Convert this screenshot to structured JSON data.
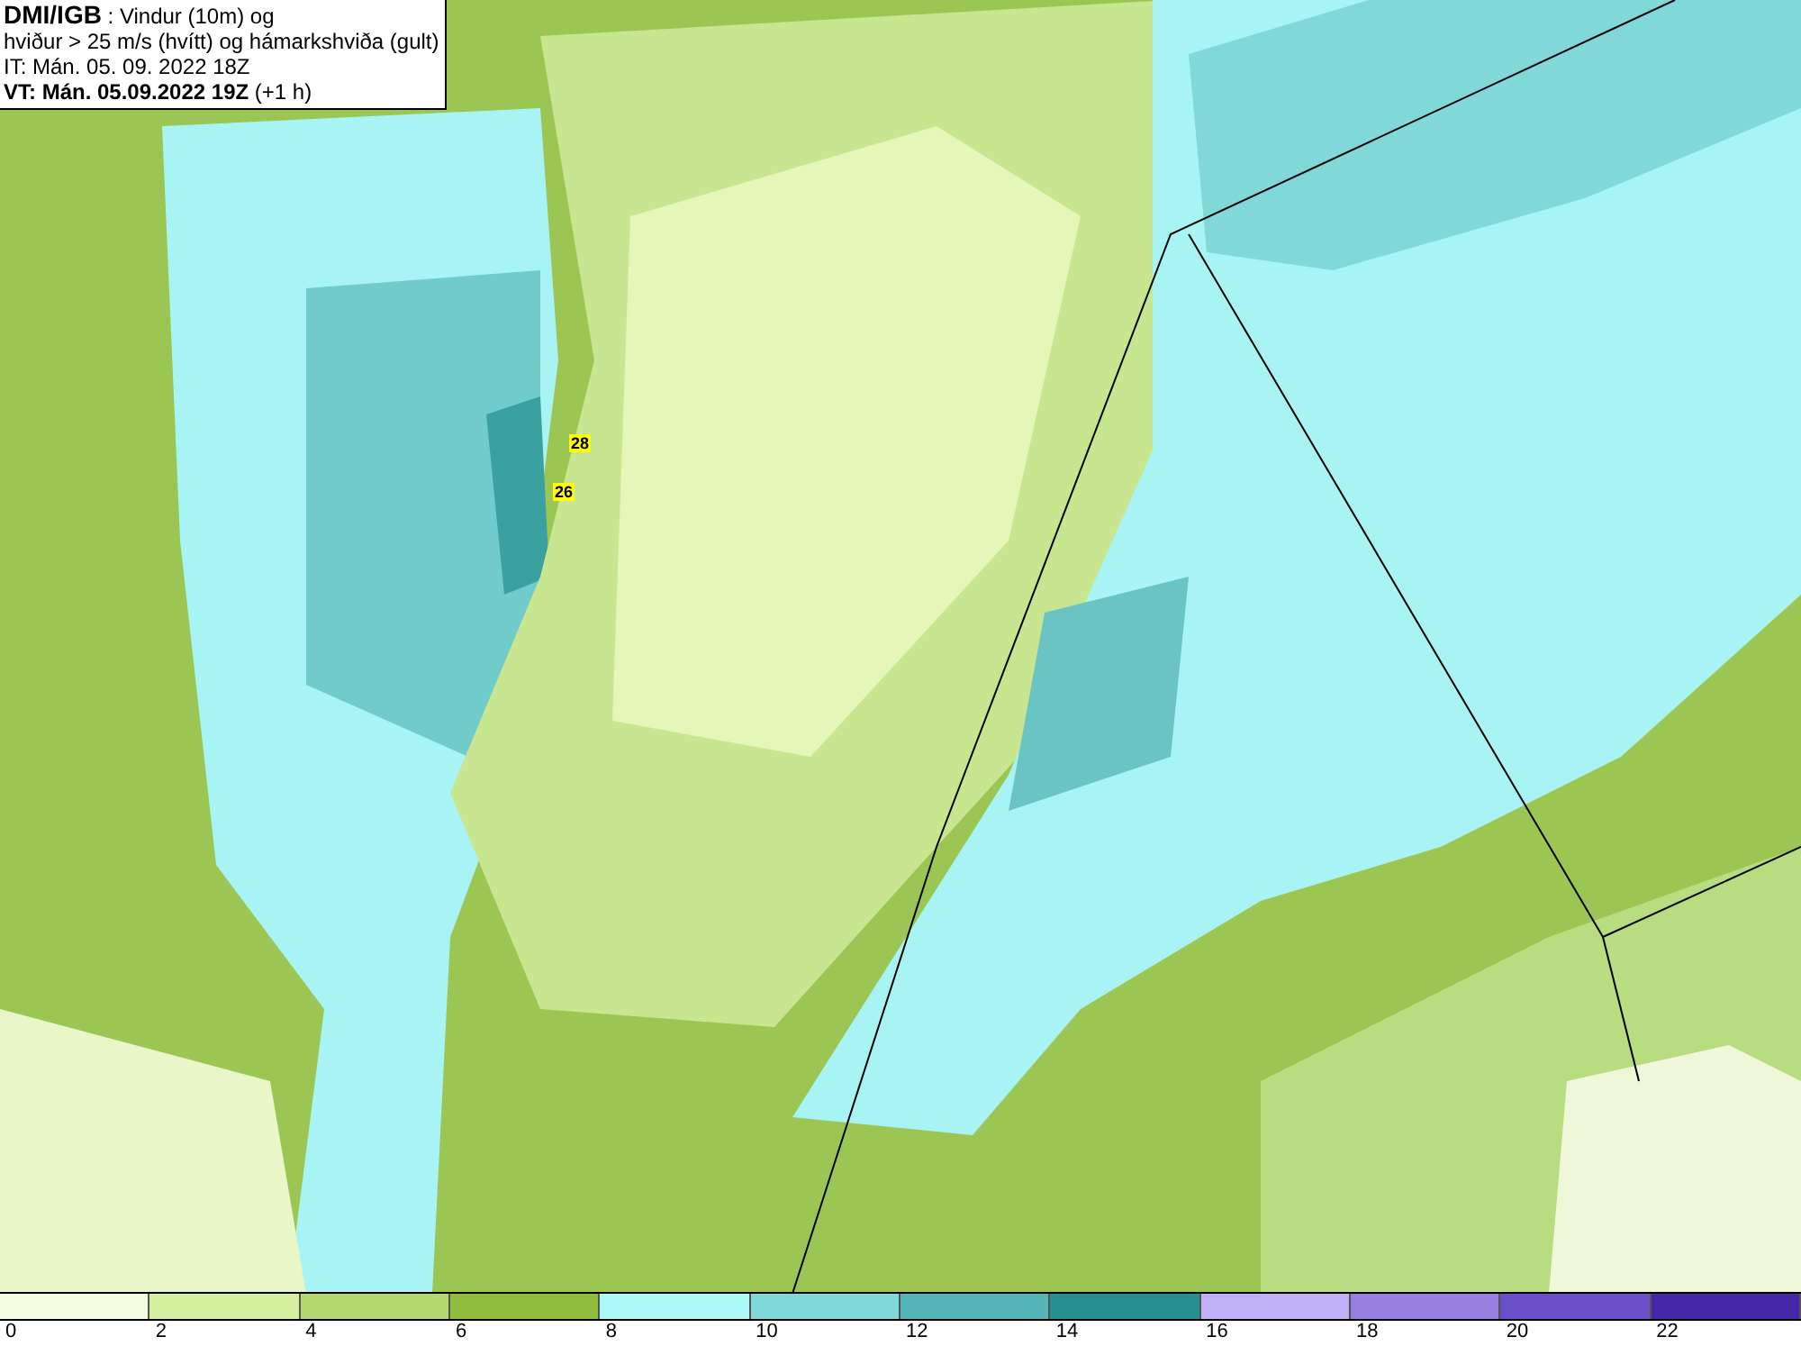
{
  "header": {
    "title": "DMI/IGB",
    "subtitle": " : Vindur (10m) og",
    "line2": "hviður > 25 m/s (hvítt) og hámarkshviða (gult)",
    "issue_time": "IT: Mán. 05. 09. 2022 18Z",
    "valid_time": "VT: Mán. 05.09.2022 19Z",
    "offset": " (+1 h)"
  },
  "map": {
    "gust_labels": [
      {
        "text": "28",
        "color": "#ffff00"
      },
      {
        "text": "26",
        "color": "#ffff00"
      }
    ]
  },
  "legend": [
    {
      "label": "0",
      "color": "#f5fde0"
    },
    {
      "label": "2",
      "color": "#d5efa0"
    },
    {
      "label": "4",
      "color": "#b3d870"
    },
    {
      "label": "6",
      "color": "#8fbe3c"
    },
    {
      "label": "8",
      "color": "#aaf8f8"
    },
    {
      "label": "10",
      "color": "#80d8d8"
    },
    {
      "label": "12",
      "color": "#55b5b8"
    },
    {
      "label": "14",
      "color": "#25908f"
    },
    {
      "label": "16",
      "color": "#c0b0f5"
    },
    {
      "label": "18",
      "color": "#9580e0"
    },
    {
      "label": "20",
      "color": "#6a50c8"
    },
    {
      "label": "22",
      "color": "#4528a8"
    }
  ]
}
